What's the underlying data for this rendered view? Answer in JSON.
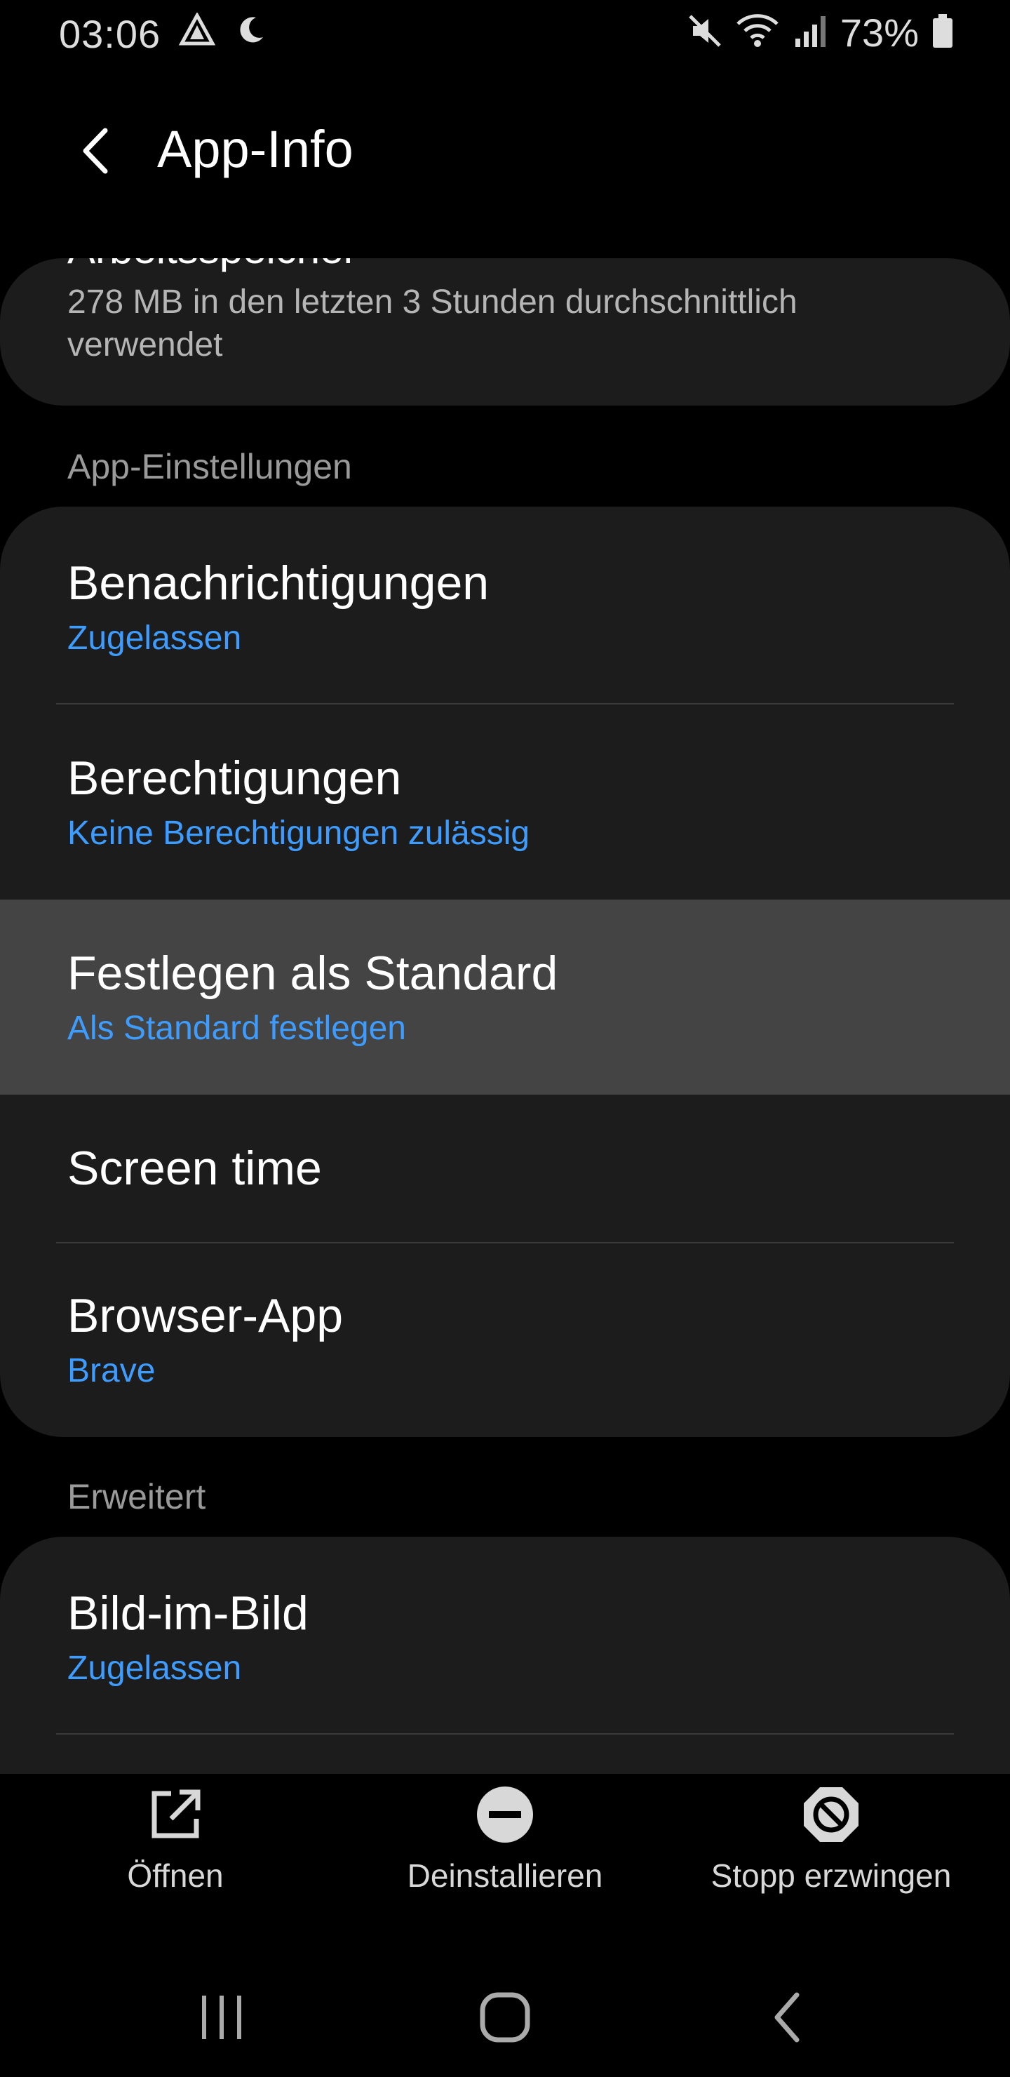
{
  "status": {
    "time": "03:06",
    "battery": "73%",
    "icons": [
      "navigation-icon",
      "dnd-moon-icon",
      "mute-icon",
      "wifi-icon",
      "signal-icon",
      "battery-icon"
    ]
  },
  "appbar": {
    "title": "App-Info"
  },
  "memory": {
    "title_cut": "Arbeitsspeicher",
    "text": "278 MB in den letzten 3 Stunden durchschnittlich verwendet"
  },
  "sections": {
    "app_settings": "App-Einstellungen",
    "advanced": "Erweitert"
  },
  "items": [
    {
      "title": "Benachrichtigungen",
      "sub": "Zugelassen"
    },
    {
      "title": "Berechtigungen",
      "sub": "Keine Berechtigungen zulässig"
    },
    {
      "title": "Festlegen als Standard",
      "sub": "Als Standard festlegen"
    },
    {
      "title": "Screen time",
      "sub": ""
    },
    {
      "title": "Browser-App",
      "sub": "Brave"
    }
  ],
  "advanced_items": [
    {
      "title": "Bild-im-Bild",
      "sub": "Zugelassen"
    }
  ],
  "actions": {
    "open": "Öffnen",
    "uninstall": "Deinstallieren",
    "force_stop": "Stopp erzwingen"
  },
  "colors": {
    "background": "#000000",
    "card": "#1c1c1c",
    "accent": "#3e9cff",
    "highlight": "#444444"
  }
}
